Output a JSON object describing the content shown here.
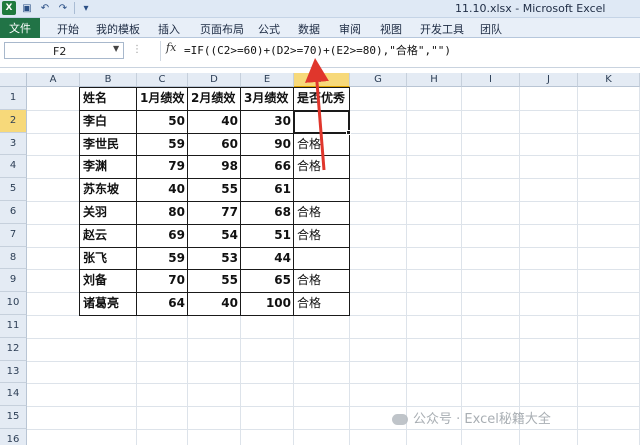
{
  "title": "11.10.xlsx - Microsoft Excel",
  "ribbon": {
    "file_tab": "文件",
    "tabs": [
      "开始",
      "我的模板",
      "插入",
      "页面布局",
      "公式",
      "数据",
      "审阅",
      "视图",
      "开发工具",
      "团队"
    ]
  },
  "formula_bar": {
    "name_box": "F2",
    "fx_label": "fx",
    "formula": "=IF((C2>=60)+(D2>=70)+(E2>=80),\"合格\",\"\")"
  },
  "columns": [
    "A",
    "B",
    "C",
    "D",
    "E",
    "F",
    "G",
    "H",
    "I",
    "J",
    "K"
  ],
  "rows": [
    "1",
    "2",
    "3",
    "4",
    "5",
    "6",
    "7",
    "8",
    "9",
    "10",
    "11",
    "12",
    "13",
    "14",
    "15",
    "16"
  ],
  "table": {
    "headers": [
      "姓名",
      "1月绩效",
      "2月绩效",
      "3月绩效",
      "是否优秀"
    ],
    "rows": [
      [
        "李白",
        "50",
        "40",
        "30",
        ""
      ],
      [
        "李世民",
        "59",
        "60",
        "90",
        "合格"
      ],
      [
        "李渊",
        "79",
        "98",
        "66",
        "合格"
      ],
      [
        "苏东坡",
        "40",
        "55",
        "61",
        ""
      ],
      [
        "关羽",
        "80",
        "77",
        "68",
        "合格"
      ],
      [
        "赵云",
        "69",
        "54",
        "51",
        "合格"
      ],
      [
        "张飞",
        "59",
        "53",
        "44",
        ""
      ],
      [
        "刘备",
        "70",
        "55",
        "65",
        "合格"
      ],
      [
        "诸葛亮",
        "64",
        "40",
        "100",
        "合格"
      ]
    ]
  },
  "watermark": "公众号 · Excel秘籍大全",
  "colors": {
    "file_tab": "#217346",
    "selected_header": "#f7d97a",
    "arrow": "#e0362c"
  }
}
